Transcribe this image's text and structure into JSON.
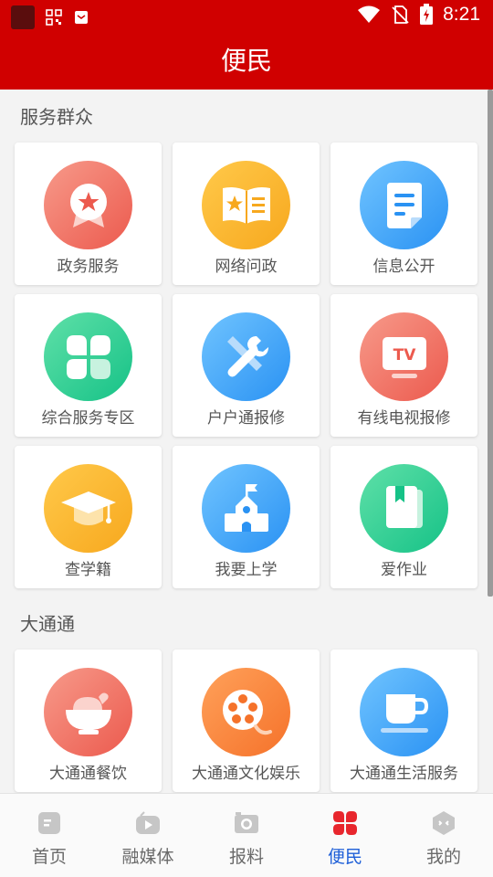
{
  "status_bar": {
    "time": "8:21"
  },
  "header": {
    "title": "便民"
  },
  "sections": [
    {
      "title": "服务群众",
      "items": [
        {
          "label": "政务服务",
          "icon": "award-badge-icon",
          "color": "#ef6a5d"
        },
        {
          "label": "网络问政",
          "icon": "open-book-star-icon",
          "color": "#f9b22c"
        },
        {
          "label": "信息公开",
          "icon": "document-icon",
          "color": "#3a9ef5"
        },
        {
          "label": "综合服务专区",
          "icon": "clover-icon",
          "color": "#22c98d"
        },
        {
          "label": "户户通报修",
          "icon": "repair-tools-icon",
          "color": "#3a9ef5"
        },
        {
          "label": "有线电视报修",
          "icon": "tv-icon",
          "color": "#ef6a5d"
        },
        {
          "label": "查学籍",
          "icon": "graduation-cap-icon",
          "color": "#f9b22c"
        },
        {
          "label": "我要上学",
          "icon": "school-building-icon",
          "color": "#3a9ef5"
        },
        {
          "label": "爱作业",
          "icon": "notebook-icon",
          "color": "#22c98d"
        }
      ]
    },
    {
      "title": "大通通",
      "items": [
        {
          "label": "大通通餐饮",
          "icon": "food-bowl-icon",
          "color": "#ef6a5d"
        },
        {
          "label": "大通通文化娱乐",
          "icon": "film-reel-icon",
          "color": "#f5782f"
        },
        {
          "label": "大通通生活服务",
          "icon": "coffee-cup-icon",
          "color": "#3a9ef5"
        }
      ]
    }
  ],
  "bottom_nav": [
    {
      "label": "首页",
      "icon": "home-doc-icon",
      "active": false
    },
    {
      "label": "融媒体",
      "icon": "media-play-icon",
      "active": false
    },
    {
      "label": "报料",
      "icon": "camera-icon",
      "active": false
    },
    {
      "label": "便民",
      "icon": "clover-icon",
      "active": true
    },
    {
      "label": "我的",
      "icon": "profile-hexagon-icon",
      "active": false
    }
  ],
  "colors": {
    "brand_red": "#d00000",
    "active_nav": "#1e5fd8"
  }
}
